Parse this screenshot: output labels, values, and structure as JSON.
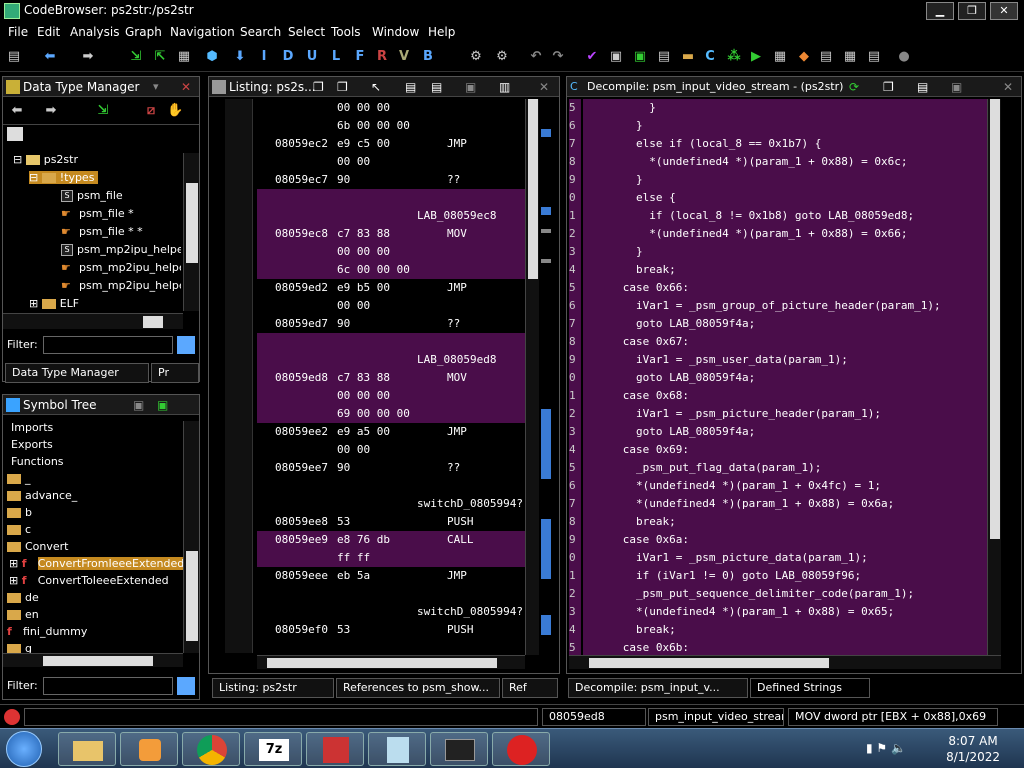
{
  "window": {
    "title": "CodeBrowser: ps2str:/ps2str",
    "min": "▁",
    "max": "❐",
    "close": "✕"
  },
  "menu": [
    "File",
    "Edit",
    "Analysis",
    "Graph",
    "Navigation",
    "Search",
    "Select",
    "Tools",
    "Window",
    "Help"
  ],
  "toolbar_letters": [
    "I",
    "D",
    "U",
    "L",
    "F",
    "R",
    "V",
    "B"
  ],
  "dtm": {
    "title": "Data Type Manager",
    "items": [
      {
        "label": "ps2str"
      },
      {
        "label": "!types"
      },
      {
        "label": "psm_file"
      },
      {
        "label": "psm_file *"
      },
      {
        "label": "psm_file * *"
      },
      {
        "label": "psm_mp2ipu_helper"
      },
      {
        "label": "psm_mp2ipu_helper"
      },
      {
        "label": "psm_mp2ipu_helper"
      },
      {
        "label": "ELF"
      }
    ],
    "filter_label": "Filter:",
    "tab1": "Data Type Manager",
    "tab2": "Pr"
  },
  "symtree": {
    "title": "Symbol Tree",
    "items": [
      {
        "label": "Imports"
      },
      {
        "label": "Exports"
      },
      {
        "label": "Functions"
      },
      {
        "label": "_"
      },
      {
        "label": "advance_"
      },
      {
        "label": "b"
      },
      {
        "label": "c"
      },
      {
        "label": "Convert"
      },
      {
        "label": "ConvertFromIeeeExtended"
      },
      {
        "label": "ConvertToIeeeExtended"
      },
      {
        "label": "de"
      },
      {
        "label": "en"
      },
      {
        "label": "fini_dummy"
      },
      {
        "label": "g"
      }
    ],
    "filter_label": "Filter:"
  },
  "listing": {
    "title": "Listing:  ps2s...",
    "lines": [
      {
        "addr": "",
        "bytes": "00 00 00",
        "op": "",
        "hl": false
      },
      {
        "addr": "",
        "bytes": "6b 00 00 00",
        "op": "",
        "hl": false
      },
      {
        "addr": "08059ec2",
        "bytes": "e9 c5 00",
        "op": "JMP",
        "hl": false
      },
      {
        "addr": "",
        "bytes": "00 00",
        "op": "",
        "hl": false
      },
      {
        "addr": "08059ec7",
        "bytes": "90",
        "op": "??",
        "hl": false
      },
      {
        "addr": "",
        "bytes": "",
        "op": "",
        "hl": true
      },
      {
        "addr": "",
        "bytes": "",
        "op": "LAB_08059ec8",
        "hl": true,
        "label": true
      },
      {
        "addr": "08059ec8",
        "bytes": "c7 83 88",
        "op": "MOV",
        "hl": true
      },
      {
        "addr": "",
        "bytes": "00 00 00",
        "op": "",
        "hl": true
      },
      {
        "addr": "",
        "bytes": "6c 00 00 00",
        "op": "",
        "hl": true
      },
      {
        "addr": "08059ed2",
        "bytes": "e9 b5 00",
        "op": "JMP",
        "hl": false
      },
      {
        "addr": "",
        "bytes": "00 00",
        "op": "",
        "hl": false
      },
      {
        "addr": "08059ed7",
        "bytes": "90",
        "op": "??",
        "hl": false
      },
      {
        "addr": "",
        "bytes": "",
        "op": "",
        "hl": true
      },
      {
        "addr": "",
        "bytes": "",
        "op": "LAB_08059ed8",
        "hl": true,
        "label": true
      },
      {
        "addr": "08059ed8",
        "bytes": "c7 83 88",
        "op": "MOV",
        "hl": true
      },
      {
        "addr": "",
        "bytes": "00 00 00",
        "op": "",
        "hl": true
      },
      {
        "addr": "",
        "bytes": "69 00 00 00",
        "op": "",
        "hl": true
      },
      {
        "addr": "08059ee2",
        "bytes": "e9 a5 00",
        "op": "JMP",
        "hl": false
      },
      {
        "addr": "",
        "bytes": "00 00",
        "op": "",
        "hl": false
      },
      {
        "addr": "08059ee7",
        "bytes": "90",
        "op": "??",
        "hl": false
      },
      {
        "addr": "",
        "bytes": "",
        "op": "",
        "hl": false
      },
      {
        "addr": "",
        "bytes": "",
        "op": "switchD_0805994?",
        "hl": false,
        "label": true
      },
      {
        "addr": "08059ee8",
        "bytes": "53",
        "op": "PUSH",
        "hl": false
      },
      {
        "addr": "08059ee9",
        "bytes": "e8 76 db",
        "op": "CALL",
        "hl": true
      },
      {
        "addr": "",
        "bytes": "ff ff",
        "op": "",
        "hl": true
      },
      {
        "addr": "08059eee",
        "bytes": "eb 5a",
        "op": "JMP",
        "hl": false
      },
      {
        "addr": "",
        "bytes": "",
        "op": "",
        "hl": false
      },
      {
        "addr": "",
        "bytes": "",
        "op": "switchD_0805994?",
        "hl": false,
        "label": true
      },
      {
        "addr": "08059ef0",
        "bytes": "53",
        "op": "PUSH",
        "hl": false
      }
    ]
  },
  "decompile": {
    "title": "Decompile: psm_input_video_stream - (ps2str)",
    "lines": [
      {
        "n": "5",
        "code": "          }"
      },
      {
        "n": "6",
        "code": "        }"
      },
      {
        "n": "7",
        "code": "        else if (local_8 == 0x1b7) {"
      },
      {
        "n": "8",
        "code": "          *(undefined4 *)(param_1 + 0x88) = 0x6c;"
      },
      {
        "n": "9",
        "code": "        }"
      },
      {
        "n": "0",
        "code": "        else {"
      },
      {
        "n": "1",
        "code": "          if (local_8 != 0x1b8) goto LAB_08059ed8;"
      },
      {
        "n": "2",
        "code": "          *(undefined4 *)(param_1 + 0x88) = 0x66;"
      },
      {
        "n": "3",
        "code": "        }"
      },
      {
        "n": "4",
        "code": "        break;"
      },
      {
        "n": "5",
        "code": "      case 0x66:"
      },
      {
        "n": "6",
        "code": "        iVar1 = _psm_group_of_picture_header(param_1);"
      },
      {
        "n": "7",
        "code": "        goto LAB_08059f4a;"
      },
      {
        "n": "8",
        "code": "      case 0x67:"
      },
      {
        "n": "9",
        "code": "        iVar1 = _psm_user_data(param_1);"
      },
      {
        "n": "0",
        "code": "        goto LAB_08059f4a;"
      },
      {
        "n": "1",
        "code": "      case 0x68:"
      },
      {
        "n": "2",
        "code": "        iVar1 = _psm_picture_header(param_1);"
      },
      {
        "n": "3",
        "code": "        goto LAB_08059f4a;"
      },
      {
        "n": "4",
        "code": "      case 0x69:"
      },
      {
        "n": "5",
        "code": "        _psm_put_flag_data(param_1);"
      },
      {
        "n": "6",
        "code": "        *(undefined4 *)(param_1 + 0x4fc) = 1;"
      },
      {
        "n": "7",
        "code": "        *(undefined4 *)(param_1 + 0x88) = 0x6a;"
      },
      {
        "n": "8",
        "code": "        break;"
      },
      {
        "n": "9",
        "code": "      case 0x6a:"
      },
      {
        "n": "0",
        "code": "        iVar1 = _psm_picture_data(param_1);"
      },
      {
        "n": "1",
        "code": "        if (iVar1 != 0) goto LAB_08059f96;"
      },
      {
        "n": "2",
        "code": "        _psm_put_sequence_delimiter_code(param_1);"
      },
      {
        "n": "3",
        "code": "        *(undefined4 *)(param_1 + 0x88) = 0x65;"
      },
      {
        "n": "4",
        "code": "        break;"
      },
      {
        "n": "5",
        "code": "      case 0x6b:"
      }
    ]
  },
  "bottom_tabs": {
    "listing": "Listing:  ps2str",
    "refs": "References to psm_show...",
    "ref2": "Ref",
    "decomp": "Decompile: psm_input_v...",
    "strings": "Defined Strings"
  },
  "status": {
    "addr": "08059ed8",
    "func": "psm_input_video_stream",
    "instr": "MOV dword ptr [EBX + 0x88],0x69"
  },
  "taskbar": {
    "time": "8:07 AM",
    "date": "8/1/2022"
  }
}
